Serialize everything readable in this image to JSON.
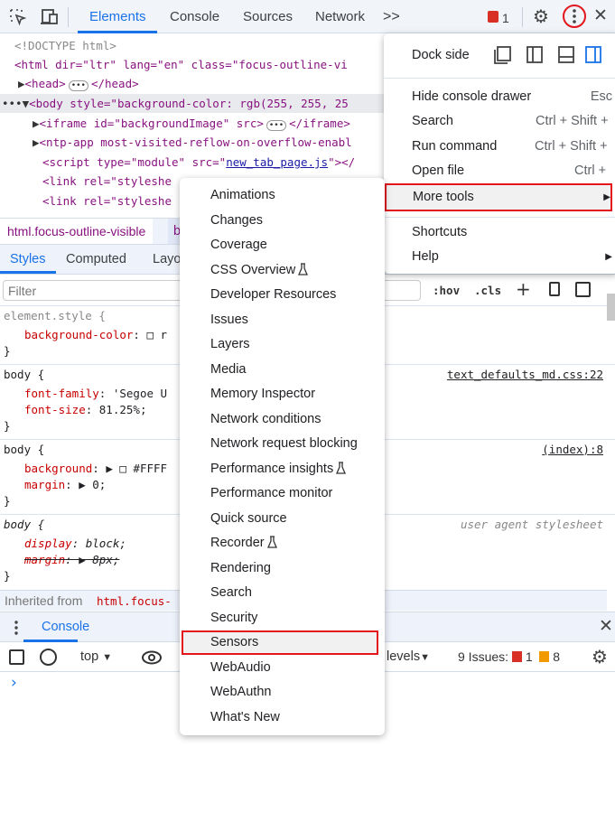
{
  "toolbar": {
    "tabs": [
      "Elements",
      "Console",
      "Sources",
      "Network"
    ],
    "active_tab": "Elements",
    "more_icon": "chevron-double-right",
    "error_count": "1",
    "icons": [
      "inspect-element-icon",
      "device-toolbar-icon",
      "settings-icon",
      "kebab-menu-icon",
      "close-icon"
    ]
  },
  "elements_tree": [
    {
      "indent": 0,
      "text": "<!DOCTYPE html>"
    },
    {
      "indent": 0,
      "text": "<html dir=\"ltr\" lang=\"en\" class=\"focus-outline-vi"
    },
    {
      "indent": 1,
      "text": "<head>",
      "ellipsis": true,
      "after": "</head>"
    },
    {
      "indent": 1,
      "text": "<body style=\"background-color: rgb(255, 255, 25"
    },
    {
      "indent": 2,
      "text": "<iframe id=\"backgroundImage\" src>",
      "ellipsis": true,
      "after": "</iframe>"
    },
    {
      "indent": 2,
      "text": "<ntp-app most-visited-reflow-on-overflow-enabl"
    },
    {
      "indent": 2,
      "text": "<script type=\"module\" src=\"",
      "link": "new_tab_page.js",
      "after": "\"></"
    },
    {
      "indent": 2,
      "text": "<link rel=\"styleshe"
    },
    {
      "indent": 2,
      "text": "<link rel=\"styleshe"
    }
  ],
  "breadcrumb": {
    "items": [
      "html.focus-outline-visible",
      "b"
    ]
  },
  "styles_tabs": [
    "Styles",
    "Computed",
    "Layo"
  ],
  "filter": {
    "placeholder": "Filter",
    "hov": ":hov",
    "cls": ".cls"
  },
  "rules": [
    {
      "selector": "element.style {",
      "decls": [
        {
          "p": "background-color",
          "v": ": □ r"
        }
      ],
      "close": "}"
    },
    {
      "selector": "body {",
      "source": "text_defaults_md.css:22",
      "decls": [
        {
          "p": "font-family",
          "v": ": 'Segoe U"
        },
        {
          "p": "font-size",
          "v": ": 81.25%;"
        }
      ],
      "close": "}"
    },
    {
      "selector": "body {",
      "source": "(index):8",
      "decls": [
        {
          "p": "background",
          "v": ": ▶ □ #FFFF"
        },
        {
          "p": "margin",
          "v": ": ▶ 0;"
        }
      ],
      "close": "}"
    },
    {
      "selector": "body {",
      "source": "user agent stylesheet",
      "decls": [
        {
          "p": "display",
          "v": ": block;"
        },
        {
          "p": "margin",
          "v": ": ▶ 8px;",
          "struck": true
        }
      ],
      "close": "}"
    }
  ],
  "inherited": {
    "label": "Inherited from",
    "selector": "html.focus-"
  },
  "console": {
    "tab": "Console",
    "context": "top",
    "levels": "levels",
    "issues_label": "9 Issues:",
    "errors": "1",
    "warnings": "8",
    "prompt": "›"
  },
  "main_menu": {
    "dock_side": "Dock side",
    "items": [
      {
        "label": "Hide console drawer",
        "shortcut": "Esc"
      },
      {
        "label": "Search",
        "shortcut": "Ctrl + Shift + F"
      },
      {
        "label": "Run command",
        "shortcut": "Ctrl + Shift + P"
      },
      {
        "label": "Open file",
        "shortcut": "Ctrl + P"
      },
      {
        "label": "More tools",
        "submenu": true,
        "highlighted": true
      }
    ],
    "items2": [
      {
        "label": "Shortcuts"
      },
      {
        "label": "Help",
        "submenu": true
      }
    ]
  },
  "more_tools": {
    "items": [
      "Animations",
      "Changes",
      "Coverage",
      "CSS Overview",
      "Developer Resources",
      "Issues",
      "Layers",
      "Media",
      "Memory Inspector",
      "Network conditions",
      "Network request blocking",
      "Performance insights",
      "Performance monitor",
      "Quick source",
      "Recorder",
      "Rendering",
      "Search",
      "Security",
      "Sensors",
      "WebAudio",
      "WebAuthn",
      "What's New"
    ],
    "experimental": [
      "CSS Overview",
      "Performance insights",
      "Recorder"
    ],
    "highlighted": "Sensors"
  },
  "colors": {
    "accent": "#1a73e8",
    "highlight_box": "#e3151d",
    "tag": "#881280",
    "attr": "#994500",
    "prop": "#c80000"
  }
}
